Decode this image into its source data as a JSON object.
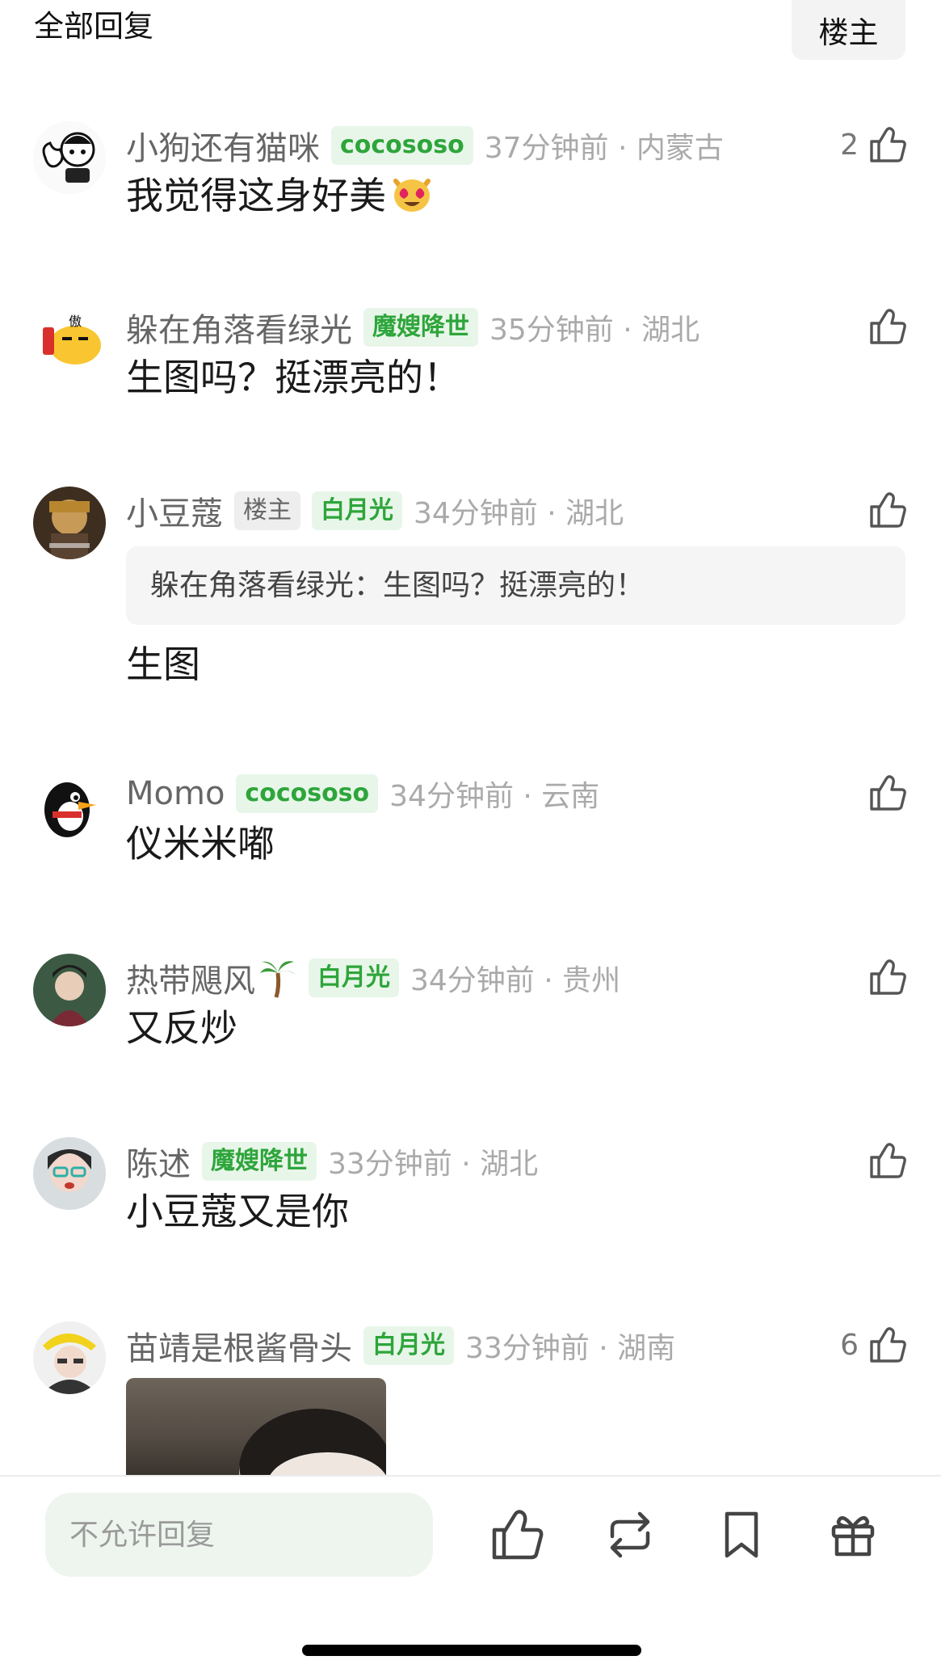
{
  "header": {
    "title": "全部回复",
    "owner_button": "楼主"
  },
  "comments": [
    {
      "username": "小狗还有猫咪",
      "owner_tag": "",
      "badge": "cocososo",
      "time": "37分钟前 · 内蒙古",
      "likes": "2",
      "text": "我觉得这身好美",
      "emoji": "heart-eyes-cat-emoji"
    },
    {
      "username": "躲在角落看绿光",
      "owner_tag": "",
      "badge": "魔嫂降世",
      "time": "35分钟前 · 湖北",
      "likes": "",
      "text": "生图吗？挺漂亮的！"
    },
    {
      "username": "小豆蔻",
      "owner_tag": "楼主",
      "badge": "白月光",
      "time": "34分钟前 · 湖北",
      "likes": "",
      "quote": "躲在角落看绿光：生图吗？挺漂亮的！",
      "text": "生图"
    },
    {
      "username": "Momo",
      "owner_tag": "",
      "badge": "cocososo",
      "time": "34分钟前 · 云南",
      "likes": "",
      "text": "仪米米嘟"
    },
    {
      "username": "热带飓风",
      "owner_tag": "",
      "badge": "白月光",
      "time": "34分钟前 · 贵州",
      "likes": "",
      "text": "又反炒",
      "name_emoji": "palm-tree-emoji"
    },
    {
      "username": "陈述",
      "owner_tag": "",
      "badge": "魔嫂降世",
      "time": "33分钟前 · 湖北",
      "likes": "",
      "text": "小豆蔻又是你"
    },
    {
      "username": "苗靖是根酱骨头",
      "owner_tag": "",
      "badge": "白月光",
      "time": "33分钟前 · 湖南",
      "likes": "6",
      "text": "",
      "has_image": true
    }
  ],
  "bottom_bar": {
    "reply_placeholder": "不允许回复",
    "icons": [
      "thumbs-up-icon",
      "repost-icon",
      "bookmark-icon",
      "gift-icon"
    ]
  },
  "colors": {
    "badge_green": "#2ea53b",
    "badge_green_bg": "#e8f6e9",
    "meta_gray": "#aaaaaa"
  }
}
